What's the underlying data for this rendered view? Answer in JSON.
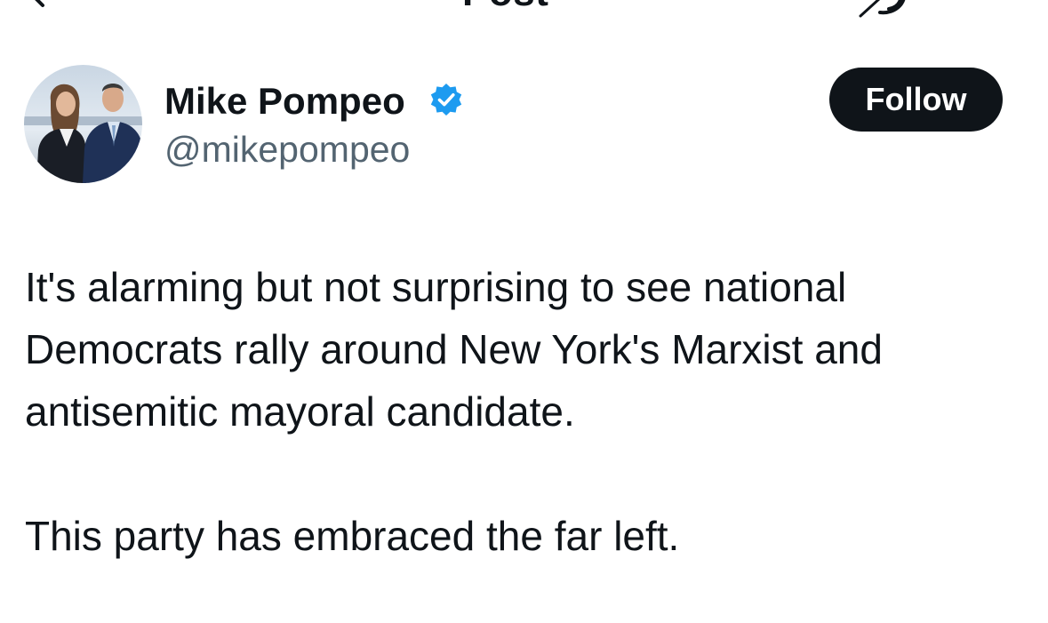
{
  "header": {
    "title": "Post",
    "back_icon": "arrow-left-icon",
    "action_icon": "grok-icon"
  },
  "author": {
    "display_name": "Mike Pompeo",
    "handle": "@mikepompeo",
    "verified": true,
    "verified_icon": "verified-badge-icon",
    "verified_color": "#1d9bf0"
  },
  "follow_button": {
    "label": "Follow",
    "background": "#0f1419",
    "text_color": "#ffffff"
  },
  "post": {
    "paragraphs": [
      "It's alarming but not surprising to see national Democrats rally around New York's Marxist and antisemitic mayoral candidate.",
      "This party has embraced the far left."
    ]
  },
  "colors": {
    "text": "#0f1419",
    "secondary_text": "#536471",
    "background": "#ffffff"
  }
}
